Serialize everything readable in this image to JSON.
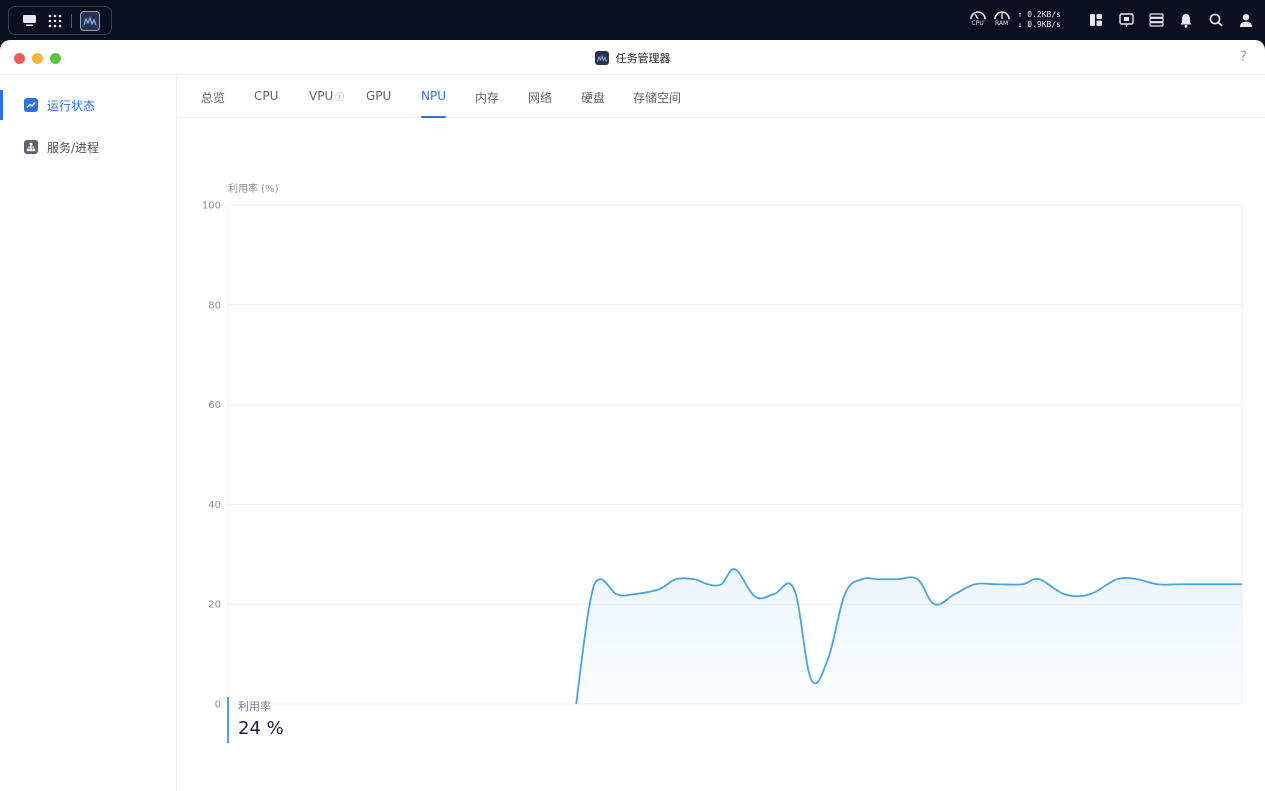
{
  "tray": {
    "cpu_label": "CPU",
    "ram_label": "RAM",
    "upload": "↑ 0.2KB/s",
    "download": "↓ 0.9KB/s"
  },
  "window": {
    "title": "任务管理器",
    "help": "?"
  },
  "sidebar": {
    "items": [
      {
        "label": "运行状态",
        "active": true
      },
      {
        "label": "服务/进程",
        "active": false
      }
    ]
  },
  "tabs": [
    {
      "label": "总览"
    },
    {
      "label": "CPU"
    },
    {
      "label": "VPU"
    },
    {
      "label": "GPU"
    },
    {
      "label": "NPU",
      "active": true
    },
    {
      "label": "内存"
    },
    {
      "label": "网络"
    },
    {
      "label": "硬盘"
    },
    {
      "label": "存储空间"
    }
  ],
  "chart_data": {
    "type": "area",
    "ylabel": "利用率 (%)",
    "ylim": [
      0,
      100
    ],
    "yticks": [
      "100",
      "80",
      "60",
      "40",
      "20",
      "0"
    ],
    "grid": true,
    "color": "#4aa3df",
    "x_range": [
      0,
      60
    ],
    "series": [
      {
        "x": [
          20.6,
          21.4,
          22,
          23,
          24,
          25.5,
          26.5,
          27.6,
          28.4,
          29.2,
          30,
          31.2,
          32.3,
          33.5,
          34.5,
          35.5,
          36.5,
          37.5,
          38.5,
          39.6,
          40.8,
          41.8,
          43,
          44.2,
          45.5,
          47,
          48,
          49.5,
          51,
          52.6,
          53.8,
          55,
          56.4,
          57.6,
          58.7,
          60
        ],
        "y": [
          0,
          20,
          25,
          22,
          22,
          23,
          25,
          25,
          24,
          24,
          27,
          21.5,
          22,
          23,
          5,
          9,
          22,
          25,
          25,
          25,
          25,
          20,
          22,
          24,
          24,
          24,
          25,
          22,
          22,
          25,
          25,
          24,
          24,
          24,
          24,
          24
        ]
      }
    ]
  },
  "readout": {
    "label": "利用率",
    "value": "24 %"
  }
}
